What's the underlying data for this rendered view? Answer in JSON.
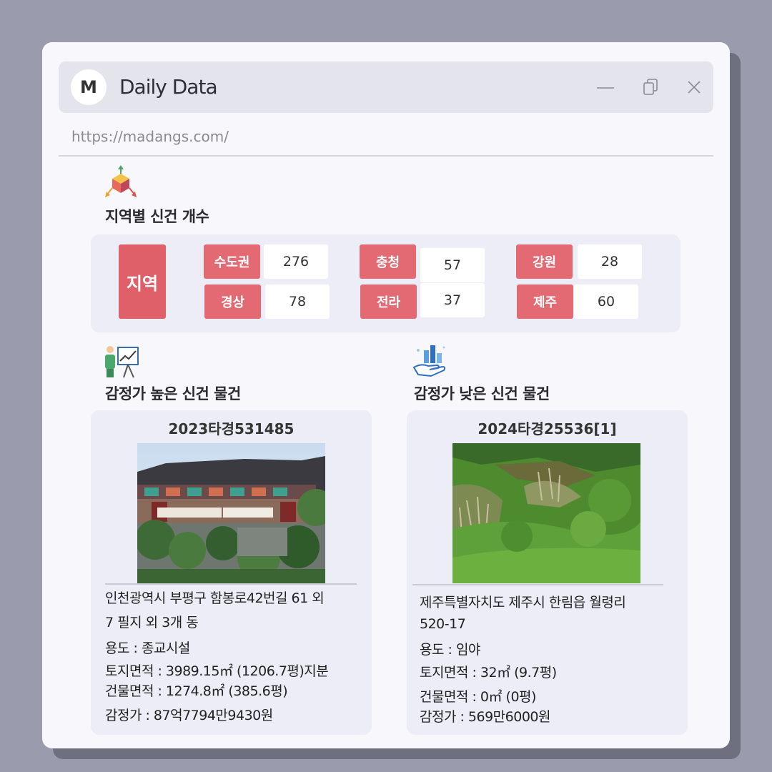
{
  "window": {
    "logo_letter": "M",
    "title": "Daily Data",
    "url": "https://madangs.com/"
  },
  "icons": {
    "minimize": "minimize-icon",
    "copy": "copy-icon",
    "close": "close-icon",
    "region_section": "cube-axes-icon",
    "high_section": "presentation-chart-icon",
    "low_section": "hand-bar-chart-icon"
  },
  "colors": {
    "accent": "#e0606a",
    "label": "#e36a72",
    "panel": "#ecedf6"
  },
  "region_section": {
    "title": "지역별 신건 개수",
    "main_label": "지역",
    "regions": [
      {
        "label": "수도권",
        "value": "276"
      },
      {
        "label": "충청",
        "value": "57"
      },
      {
        "label": "강원",
        "value": "28"
      },
      {
        "label": "경상",
        "value": "78"
      },
      {
        "label": "전라",
        "value": "37"
      },
      {
        "label": "제주",
        "value": "60"
      }
    ]
  },
  "high": {
    "title": "감정가 높은 신건 물건",
    "case_id": "2023타경531485",
    "address_line1": "인천광역시 부평구 함봉로42번길 61 외",
    "address_line2": "7 필지 외 3개 동",
    "usage": "용도 : 종교시설",
    "land_area": "토지면적 : 3989.15㎡ (1206.7평)지분",
    "building_area": "건물면적 : 1274.8㎡ (385.6평)",
    "appraisal": "감정가 : 87억7794만9430원"
  },
  "low": {
    "title": "감정가 낮은 신건 물건",
    "case_id": "2024타경25536[1]",
    "address_line1": "제주특별자치도 제주시 한림읍 월령리",
    "address_line2": "520-17",
    "usage": "용도 :  임야",
    "land_area": "토지면적 : 32㎡ (9.7평)",
    "building_area": "건물면적 : 0㎡ (0평)",
    "appraisal": "감정가 : 569만6000원"
  }
}
